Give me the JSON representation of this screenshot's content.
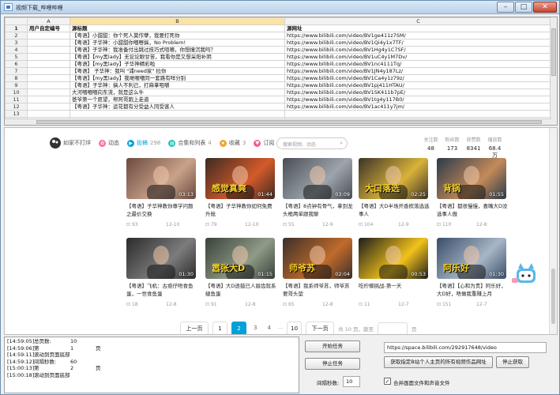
{
  "window": {
    "title": "视频下载_哔哩哔哩",
    "btn_min": "–",
    "btn_max": "□",
    "btn_close": "✕"
  },
  "grid": {
    "col_letters": [
      "A",
      "B",
      "C"
    ],
    "headers": [
      "用户自定编号",
      "源标题",
      "源网址"
    ],
    "row_numbers": [
      "1",
      "2",
      "3",
      "4",
      "5",
      "6",
      "7",
      "8",
      "9",
      "10",
      "11",
      "12",
      "13",
      "14",
      "15"
    ],
    "rows": [
      [
        "",
        "【粤语】小甜甜：你个死人莫作孽，我要打死你",
        "https://www.bilibili.com/video/BV1ge411z7SM/"
      ],
      [
        "",
        "【粤语】子华神：小甜甜你嗰嘢搞，No Problem!",
        "https://www.bilibili.com/video/BV1Qi4y1x7TF/"
      ],
      [
        "",
        "【粤语】子华神：我准备付出跳过技巧式咀嚼，你想撞沉我吗？",
        "https://www.bilibili.com/video/BV1Hg4y1C7SF/"
      ],
      [
        "",
        "【粤语】【my黑lady】无论论眼甘苦，我看你是又想采阳补阴",
        "https://www.bilibili.com/video/BV1uC4y1M7Dv/"
      ],
      [
        "",
        "【粤语】【my黑lady】子华神精彩啦",
        "https://www.bilibili.com/video/BV1nc4111Tq/"
      ],
      [
        "",
        "【粤语】 子华神：我叫 \"浦need家\" 拉你",
        "https://www.bilibili.com/video/BV1JN4y187Lz/"
      ],
      [
        "",
        "【粤语】【my黑lady】我哋喱嗰同一套路有咩分别",
        "https://www.bilibili.com/video/BV1Ca4y1z79z/"
      ],
      [
        "",
        "【粤语】子华神：搞人不利己，打麻拿咀嚼",
        "https://www.bilibili.com/video/BV1pj411HTAU/"
      ],
      [
        "",
        "大河嗰嗰嗰向东流，就是这么牛",
        "https://www.bilibili.com/video/BV1SK411b7pE/"
      ],
      [
        "",
        "爸爷第一个愿望，帮阿哥跑上走道",
        "https://www.bilibili.com/video/BV1tg4y117B0/"
      ],
      [
        "",
        "【粤语】子华神：运花都有分受益人同受害人",
        "https://www.bilibili.com/video/BV1ac411y7jm/"
      ],
      [
        "",
        "",
        ""
      ],
      [
        "",
        "",
        ""
      ]
    ]
  },
  "browser": {
    "tabs": [
      {
        "label": "如家不打烊",
        "n": ""
      },
      {
        "label": "动态",
        "n": ""
      },
      {
        "label": "投稿",
        "n": "298"
      },
      {
        "label": "合集和列表",
        "n": "4"
      },
      {
        "label": "收藏",
        "n": "3"
      },
      {
        "label": "订阅",
        "n": ""
      }
    ],
    "search_placeholder": "搜索视频、动态",
    "stats": [
      {
        "label": "关注数",
        "value": "48"
      },
      {
        "label": "粉丝数",
        "value": "173"
      },
      {
        "label": "获赞数",
        "value": "8341"
      },
      {
        "label": "播放数",
        "value": "68.4万"
      }
    ],
    "videos": [
      {
        "dur": "03:13",
        "title": "【粤语】子华神教你尊学问题之最价交换",
        "plays": "93",
        "date": "12-10",
        "colors": [
          "#6b4a3e",
          "#c9a28a"
        ]
      },
      {
        "dur": "01:44",
        "title": "【粤语】子华神教你如何免费升舱",
        "plays": "79",
        "date": "12-10",
        "colors": [
          "#3d2a22",
          "#d45a2a"
        ],
        "overlay": "感觉真爽"
      },
      {
        "dur": "03:09",
        "title": "【粤语】8点钟有骨气，拿到龙头桅两单跟我聊",
        "plays": "55",
        "date": "12-9",
        "colors": [
          "#4a4f57",
          "#9ea4ab"
        ]
      },
      {
        "dur": "02:25",
        "title": "【粤语】大D半场开香槟落选选事人",
        "plays": "104",
        "date": "12-9",
        "colors": [
          "#3c3328",
          "#d9b23a"
        ],
        "overlay": "大口落选"
      },
      {
        "dur": "01:55",
        "title": "【粤语】都很慢慢，喜嘴大D没选事人傲",
        "plays": "110",
        "date": "12-8",
        "colors": [
          "#2a3a4a",
          "#c48a5a"
        ],
        "overlay": "背锅"
      },
      {
        "dur": "01:30",
        "title": "【粤语】飞机：古惑仔唔食鱼蛋，一世食鱼蛋",
        "plays": "18",
        "date": "12-8",
        "colors": [
          "#2b2b2b",
          "#7c7c7c"
        ]
      },
      {
        "dur": "01:15",
        "title": "【粤语】大D逐鼓已人眉齿就系缝鱼蛋",
        "plays": "91",
        "date": "12-8",
        "colors": [
          "#39423a",
          "#8f9a87"
        ],
        "overlay": "嚣张大D"
      },
      {
        "dur": "02:04",
        "title": "【粤语】我系师爷苏，师爷苏要哥头堃",
        "plays": "65",
        "date": "12-8",
        "colors": [
          "#3b2f2a",
          "#c06b2b"
        ],
        "overlay": "师爷苏"
      },
      {
        "dur": "00:53",
        "title": "吃柠檬挑战-第一天",
        "plays": "11",
        "date": "12-7",
        "colors": [
          "#1d1d1d",
          "#f2c21a"
        ]
      },
      {
        "dur": "01:30",
        "title": "【粤语】【心和为贵】阿乐好，大D好，唔做我重赚上月",
        "plays": "151",
        "date": "12-7",
        "colors": [
          "#3a4e6a",
          "#a8b6c6"
        ],
        "overlay": "阿乐好"
      }
    ],
    "pager": {
      "prev": "上一页",
      "pages": [
        "1",
        "2",
        "3",
        "4"
      ],
      "ellipsis": "···",
      "last": "10",
      "next": "下一页",
      "total": "共 10 页，跳至",
      "page_unit": "页",
      "current": "2"
    }
  },
  "log": [
    {
      "t": "[14:59:05]",
      "a": "总页数:",
      "b": "10",
      "c": ""
    },
    {
      "t": "[14:59:06]",
      "a": "第",
      "b": "1",
      "c": "页"
    },
    {
      "t": "[14:59:11]",
      "a": "滚动到页面底部",
      "b": "",
      "c": ""
    },
    {
      "t": "[14:59:12]",
      "a": "间隔秒数:",
      "b": "60",
      "c": ""
    },
    {
      "t": "[15:00:13]",
      "a": "第",
      "b": "2",
      "c": "页"
    },
    {
      "t": "[15:00:18]",
      "a": "滚动到页面底部",
      "b": "",
      "c": ""
    }
  ],
  "controls": {
    "start": "开始任务",
    "stop": "停止任务",
    "interval_label": "间隔秒数:",
    "interval_value": "10",
    "url_value": "https://space.bilibili.com/292917648/video",
    "fetch": "获取指定B站个人主页的所有视频作品网址",
    "stop_fetch": "停止获取",
    "merge_label": "合并画面文件和声音文件",
    "merge_checked": "✓"
  }
}
